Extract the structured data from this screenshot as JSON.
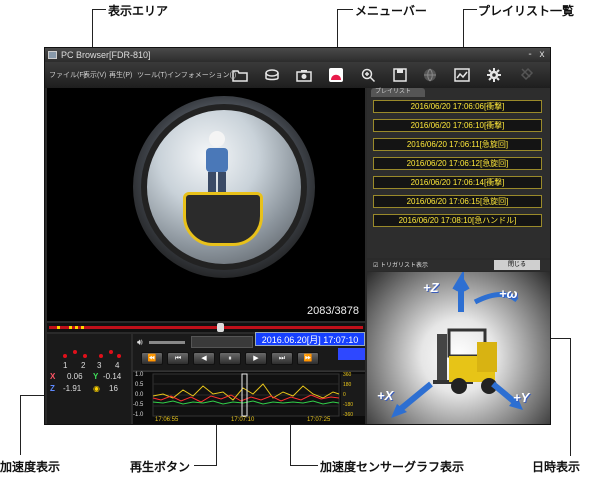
{
  "callouts": {
    "display_area": "表示エリア",
    "menu_bar": "メニューバー",
    "playlist": "プレイリスト一覧",
    "accel_display": "加速度表示",
    "play_button": "再生ボタン",
    "accel_graph": "加速度センサーグラフ表示",
    "datetime_display": "日時表示"
  },
  "window": {
    "title": "PC Browser[FDR-810]",
    "minimize": "-",
    "close": "x"
  },
  "menu": [
    "ファイル(F)",
    "表示(V)",
    "再生(P)",
    "ツール(T)",
    "インフォメーション(I)"
  ],
  "toolbar_icons": [
    "folder-icon",
    "drive-icon",
    "camera-icon",
    "record-icon",
    "zoom-icon",
    "save-icon",
    "globe-icon",
    "chart-icon",
    "settings-icon",
    "pin-icon"
  ],
  "video": {
    "frame_counter": "2083/3878"
  },
  "accel": {
    "channels": [
      "1",
      "2",
      "3",
      "4"
    ],
    "x_label": "X",
    "y_label": "Y",
    "z_label": "Z",
    "x_value": "0.06",
    "y_value": "-0.14",
    "z_value": "-1.91",
    "g_value": "16"
  },
  "datetime": "2016.06.20[月] 17:07:10",
  "playback": [
    "⏪",
    "⏮",
    "◀",
    "⏸",
    "▶",
    "⏭",
    "⏩"
  ],
  "graph": {
    "y_ticks": [
      "1.0",
      "0.5",
      "0.0",
      "-0.5",
      "-1.0"
    ],
    "x_ticks": [
      "17:06:55",
      "17:07:10",
      "17:07:25"
    ],
    "right_ticks": [
      "360",
      "180",
      "0",
      "-180",
      "-360"
    ]
  },
  "playlist": {
    "tab": "プレイリスト",
    "items": [
      "2016/06/20 17:06:06[衝撃]",
      "2016/06/20 17:06:10[衝撃]",
      "2016/06/20 17:06:11[急旋回]",
      "2016/06/20 17:06:12[急旋回]",
      "2016/06/20 17:06:14[衝撃]",
      "2016/06/20 17:06:15[急旋回]",
      "2016/06/20 17:08:10[急ハンドル]"
    ],
    "trigger_list_label": "トリガリスト表示",
    "close_label": "閉じる"
  },
  "axes": {
    "z": "+Z",
    "omega": "+ω",
    "x": "+X",
    "y": "+Y"
  }
}
